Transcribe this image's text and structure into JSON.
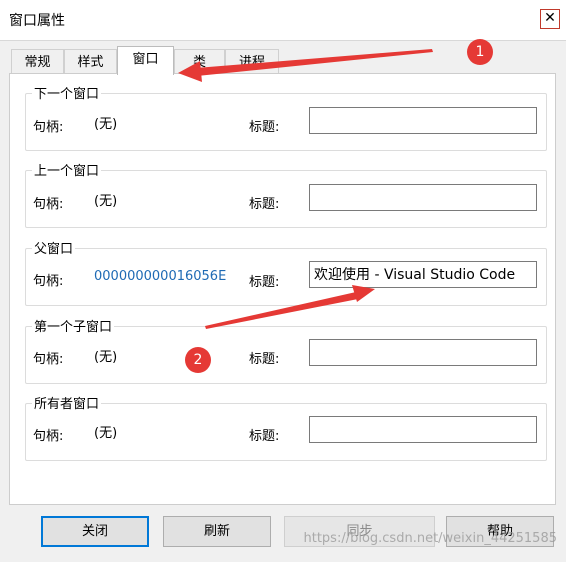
{
  "window": {
    "title": "窗口属性",
    "close_glyph": "✕"
  },
  "tabs": [
    {
      "label": "常规"
    },
    {
      "label": "样式"
    },
    {
      "label": "窗口"
    },
    {
      "label": "类"
    },
    {
      "label": "进程"
    }
  ],
  "active_tab": "窗口",
  "groups": {
    "next": {
      "title": "下一个窗口",
      "handle_label": "句柄:",
      "handle_value": "(无)",
      "caption_label": "标题:",
      "caption_value": ""
    },
    "prev": {
      "title": "上一个窗口",
      "handle_label": "句柄:",
      "handle_value": "(无)",
      "caption_label": "标题:",
      "caption_value": ""
    },
    "parent": {
      "title": "父窗口",
      "handle_label": "句柄:",
      "handle_value": "000000000016056E",
      "caption_label": "标题:",
      "caption_value": "欢迎使用 - Visual Studio Code"
    },
    "child": {
      "title": "第一个子窗口",
      "handle_label": "句柄:",
      "handle_value": "(无)",
      "caption_label": "标题:",
      "caption_value": ""
    },
    "owner": {
      "title": "所有者窗口",
      "handle_label": "句柄:",
      "handle_value": "(无)",
      "caption_label": "标题:",
      "caption_value": ""
    }
  },
  "buttons": {
    "close": "关闭",
    "refresh": "刷新",
    "sync": "同步",
    "help": "帮助"
  },
  "annotations": {
    "badge1": "1",
    "badge2": "2",
    "color": "#e53935"
  },
  "watermark": "https://blog.csdn.net/weixin_44251585",
  "colors": {
    "link": "#1e6ab4",
    "default_button_border": "#0078d7"
  }
}
